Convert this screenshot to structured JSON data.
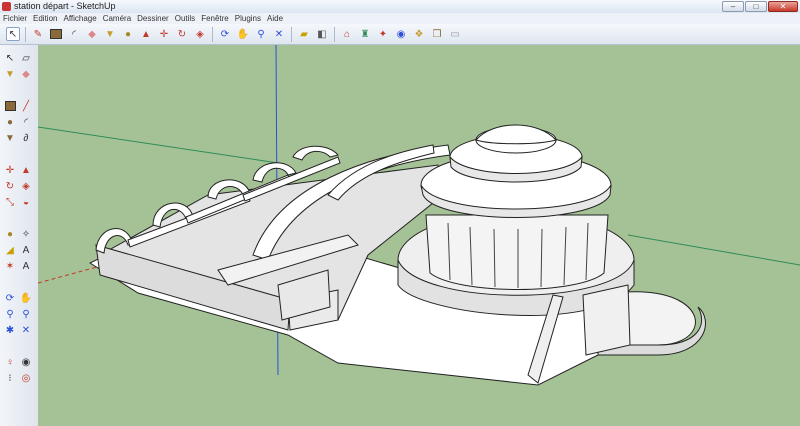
{
  "window": {
    "title": "station départ - SketchUp"
  },
  "menu": [
    "Fichier",
    "Edition",
    "Affichage",
    "Caméra",
    "Dessiner",
    "Outils",
    "Fenêtre",
    "Plugins",
    "Aide"
  ],
  "toolbar_icons": [
    "select-arrow-icon",
    "pencil-icon",
    "rectangle-icon",
    "arc-icon",
    "eraser-icon",
    "paint-bucket-icon",
    "tape-measure-icon",
    "push-pull-icon",
    "move-icon",
    "rotate-icon",
    "offset-icon",
    "orbit-icon",
    "pan-icon",
    "zoom-extents-icon",
    "section-plane-icon",
    "component-icon",
    "warehouse-icon",
    "style-icon",
    "layer-icon",
    "shadow-icon"
  ],
  "sidebar_icons": [
    "select-arrow-icon",
    "component-icon",
    "paint-bucket-icon",
    "eraser-icon",
    "rectangle-icon",
    "line-icon",
    "circle-icon",
    "arc-icon",
    "polygon-icon",
    "freehand-icon",
    "move-icon",
    "push-pull-icon",
    "rotate-icon",
    "follow-me-icon",
    "scale-icon",
    "offset-icon",
    "tape-measure-icon",
    "dimension-icon",
    "protractor-icon",
    "text-icon",
    "axes-icon",
    "3d-text-icon",
    "orbit-icon",
    "pan-icon",
    "zoom-icon",
    "zoom-window-icon",
    "previous-view-icon",
    "zoom-extents-icon",
    "position-camera-icon",
    "look-around-icon",
    "walk-icon",
    "section-plane-icon"
  ],
  "colors": {
    "sky_ground": "#a5c296",
    "axis_red": "#c0392b",
    "axis_green": "#2e8b57",
    "axis_blue": "#2c4fd8",
    "model_face": "#ffffff",
    "model_edge": "#222222"
  }
}
